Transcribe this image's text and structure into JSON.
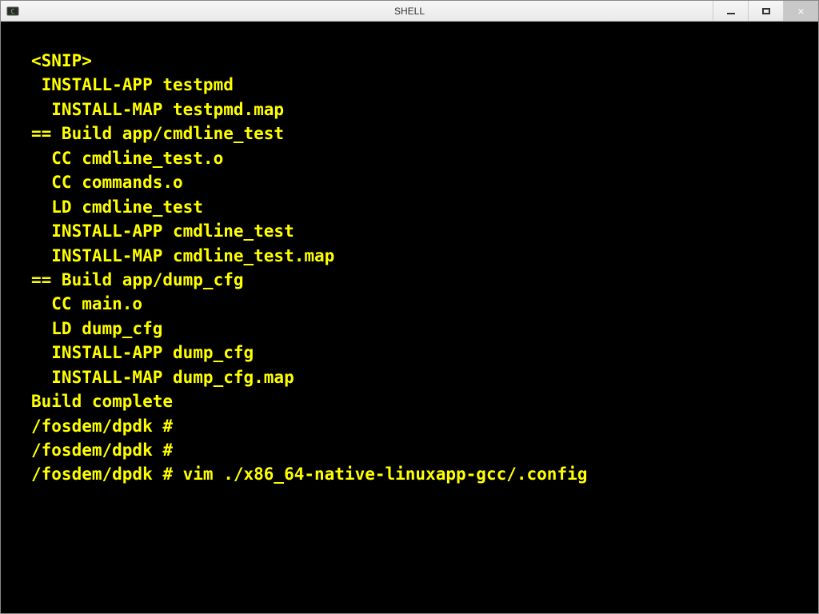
{
  "window": {
    "title": "SHELL"
  },
  "terminal": {
    "lines": [
      "<SNIP>",
      " INSTALL-APP testpmd",
      "  INSTALL-MAP testpmd.map",
      "== Build app/cmdline_test",
      "  CC cmdline_test.o",
      "  CC commands.o",
      "  LD cmdline_test",
      "  INSTALL-APP cmdline_test",
      "  INSTALL-MAP cmdline_test.map",
      "== Build app/dump_cfg",
      "  CC main.o",
      "  LD dump_cfg",
      "  INSTALL-APP dump_cfg",
      "  INSTALL-MAP dump_cfg.map",
      "Build complete",
      "/fosdem/dpdk #",
      "/fosdem/dpdk #",
      "/fosdem/dpdk # vim ./x86_64-native-linuxapp-gcc/.config"
    ]
  },
  "colors": {
    "terminal_fg": "#ffff00",
    "terminal_bg": "#000000"
  }
}
